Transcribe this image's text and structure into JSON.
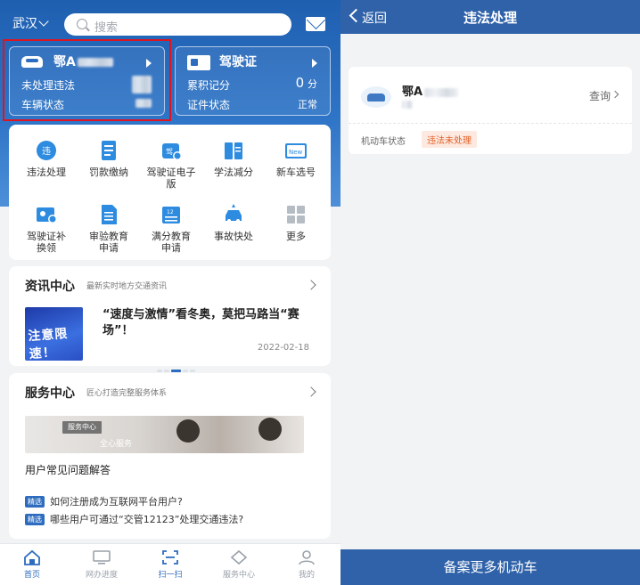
{
  "left": {
    "city": "武汉",
    "search_placeholder": "搜索",
    "vehicle_card": {
      "plate": "鄂A",
      "row1_label": "未处理违法",
      "row2_label": "车辆状态"
    },
    "license_card": {
      "title": "驾驶证",
      "row1_label": "累积记分",
      "row1_value": "0",
      "row1_unit": "分",
      "row2_label": "证件状态",
      "row2_value": "正常"
    },
    "services": [
      {
        "label": "违法处理",
        "icon": "violation-icon"
      },
      {
        "label": "罚款缴纳",
        "icon": "fine-icon"
      },
      {
        "label": "驾驶证电子版",
        "icon": "e-license-icon"
      },
      {
        "label": "学法减分",
        "icon": "study-icon"
      },
      {
        "label": "新车选号",
        "icon": "new-plate-icon"
      },
      {
        "label": "驾驶证补换领",
        "icon": "license-renew-icon"
      },
      {
        "label": "审验教育申请",
        "icon": "review-edu-icon"
      },
      {
        "label": "满分教育申请",
        "icon": "fullscore-edu-icon"
      },
      {
        "label": "事故快处",
        "icon": "accident-icon"
      },
      {
        "label": "更多",
        "icon": "more-icon"
      }
    ],
    "news": {
      "title": "资讯中心",
      "subtitle": "最新实时地方交通资讯",
      "image_text": "注意限速！",
      "headline": "“速度与激情”看冬奥，莫把马路当“赛场”！",
      "date": "2022-02-18"
    },
    "service_center": {
      "title": "服务中心",
      "subtitle": "匠心打造完整服务体系",
      "banner_tag": "服务中心",
      "banner_slogan": "全心服务",
      "faq_title": "用户常见问题解答",
      "faq_tag": "精选",
      "faqs": [
        "如何注册成为互联网平台用户?",
        "哪些用户可通过“交管12123”处理交通违法?"
      ]
    },
    "tabs": [
      {
        "label": "首页",
        "icon": "home-icon"
      },
      {
        "label": "网办进度",
        "icon": "progress-icon"
      },
      {
        "label": "扫一扫",
        "icon": "scan-icon"
      },
      {
        "label": "服务中心",
        "icon": "service-icon"
      },
      {
        "label": "我的",
        "icon": "profile-icon"
      }
    ]
  },
  "right": {
    "back_label": "返回",
    "title": "违法处理",
    "plate": "鄂A",
    "query_label": "查询",
    "status_label": "机动车状态",
    "status_value": "违法未处理",
    "bottom_button": "备案更多机动车"
  }
}
